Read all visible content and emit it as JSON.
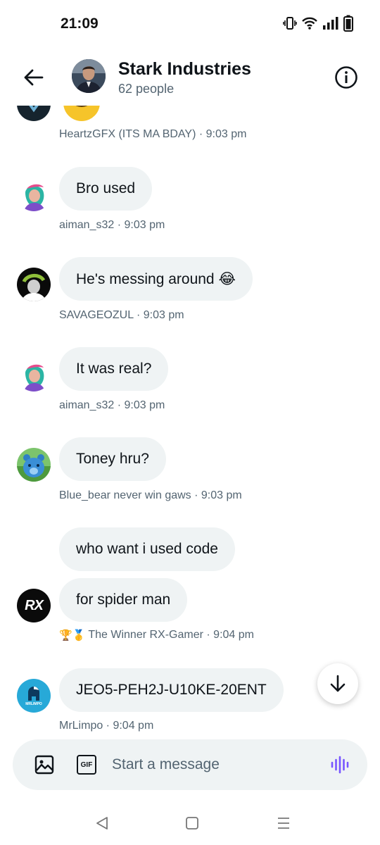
{
  "status_bar": {
    "time": "21:09",
    "icons": [
      "vibrate-icon",
      "wifi-icon",
      "signal-icon",
      "battery-icon"
    ]
  },
  "header": {
    "title": "Stark Industries",
    "subtitle": "62 people",
    "back_icon": "arrow-left-icon",
    "info_icon": "info-icon"
  },
  "messages": [
    {
      "text": "",
      "meta": "HeartzGFX (ITS MA BDAY) · 9:03 pm"
    },
    {
      "text": "Bro used",
      "meta": "aiman_s32 · 9:03 pm"
    },
    {
      "text": "He's messing around 😂",
      "meta": "SAVAGEOZUL · 9:03 pm"
    },
    {
      "text": "It was real?",
      "meta": "aiman_s32 · 9:03 pm"
    },
    {
      "text": "Toney hru?",
      "meta": "Blue_bear never win gaws · 9:03 pm"
    },
    {
      "text": "who want i used code",
      "meta": ""
    },
    {
      "text": "for spider man",
      "meta": "The Winner RX-Gamer · 9:04 pm",
      "meta_emoji": "🏆🥇"
    },
    {
      "text": "JEO5-PEH2J-U10KE-20ENT",
      "meta": "MrLimpo · 9:04 pm"
    }
  ],
  "avatars": {
    "rx_text": "RX",
    "mrlimpo_text": "MRLIMPO"
  },
  "composer": {
    "placeholder": "Start a message",
    "value": "",
    "gif_label": "GIF",
    "accent_color": "#7856ff"
  },
  "colors": {
    "bubble": "#eff3f4",
    "meta_text": "#536471",
    "text": "#0f1419"
  }
}
